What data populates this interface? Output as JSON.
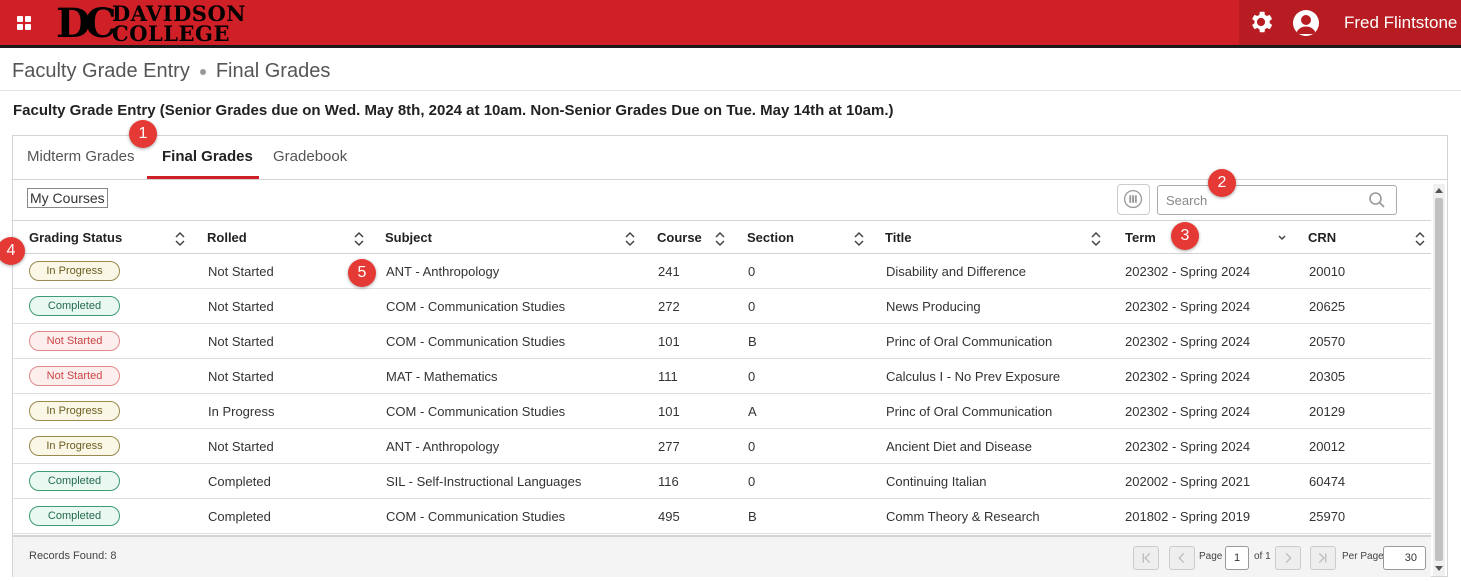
{
  "header": {
    "logo_mark": "DC",
    "logo_line1": "DAVIDSON",
    "logo_line2": "COLLEGE",
    "user_name": "Fred Flintstone",
    "accent_color": "#cf2027"
  },
  "breadcrumb": {
    "items": [
      "Faculty Grade Entry",
      "Final Grades"
    ]
  },
  "page_title": "Faculty Grade Entry (Senior Grades due on Wed. May 8th, 2024 at 10am. Non-Senior Grades Due on Tue. May 14th at 10am.)",
  "tabs": [
    {
      "label": "Midterm Grades",
      "active": false
    },
    {
      "label": "Final Grades",
      "active": true
    },
    {
      "label": "Gradebook",
      "active": false
    }
  ],
  "toolbar": {
    "my_courses_label": "My Courses",
    "search_placeholder": "Search",
    "search_value": ""
  },
  "table": {
    "columns": [
      "Grading Status",
      "Rolled",
      "Subject",
      "Course",
      "Section",
      "Title",
      "Term",
      "CRN"
    ],
    "rows": [
      {
        "status": "In Progress",
        "status_kind": "inprogress",
        "rolled": "Not Started",
        "subject": "ANT - Anthropology",
        "course": "241",
        "section": "0",
        "title": "Disability and Difference",
        "term": "202302 - Spring 2024",
        "crn": "20010"
      },
      {
        "status": "Completed",
        "status_kind": "completed",
        "rolled": "Not Started",
        "subject": "COM - Communication Studies",
        "course": "272",
        "section": "0",
        "title": "News Producing",
        "term": "202302 - Spring 2024",
        "crn": "20625"
      },
      {
        "status": "Not Started",
        "status_kind": "notstarted",
        "rolled": "Not Started",
        "subject": "COM - Communication Studies",
        "course": "101",
        "section": "B",
        "title": "Princ of Oral Communication",
        "term": "202302 - Spring 2024",
        "crn": "20570"
      },
      {
        "status": "Not Started",
        "status_kind": "notstarted",
        "rolled": "Not Started",
        "subject": "MAT - Mathematics",
        "course": "111",
        "section": "0",
        "title": "Calculus I - No Prev Exposure",
        "term": "202302 - Spring 2024",
        "crn": "20305"
      },
      {
        "status": "In Progress",
        "status_kind": "inprogress",
        "rolled": "In Progress",
        "subject": "COM - Communication Studies",
        "course": "101",
        "section": "A",
        "title": "Princ of Oral Communication",
        "term": "202302 - Spring 2024",
        "crn": "20129"
      },
      {
        "status": "In Progress",
        "status_kind": "inprogress",
        "rolled": "Not Started",
        "subject": "ANT - Anthropology",
        "course": "277",
        "section": "0",
        "title": "Ancient Diet and Disease",
        "term": "202302 - Spring 2024",
        "crn": "20012"
      },
      {
        "status": "Completed",
        "status_kind": "completed",
        "rolled": "Completed",
        "subject": "SIL - Self-Instructional Languages",
        "course": "116",
        "section": "0",
        "title": "Continuing Italian",
        "term": "202002 - Spring 2021",
        "crn": "60474"
      },
      {
        "status": "Completed",
        "status_kind": "completed",
        "rolled": "Completed",
        "subject": "COM - Communication Studies",
        "course": "495",
        "section": "B",
        "title": "Comm Theory & Research",
        "term": "201802 - Spring 2019",
        "crn": "25970"
      }
    ]
  },
  "footer": {
    "records_label": "Records Found: 8",
    "page_label": "Page",
    "page_value": "1",
    "of_label": "of 1",
    "per_page_label": "Per Page",
    "per_page_value": "30"
  },
  "markers": [
    "1",
    "2",
    "3",
    "4",
    "5"
  ]
}
